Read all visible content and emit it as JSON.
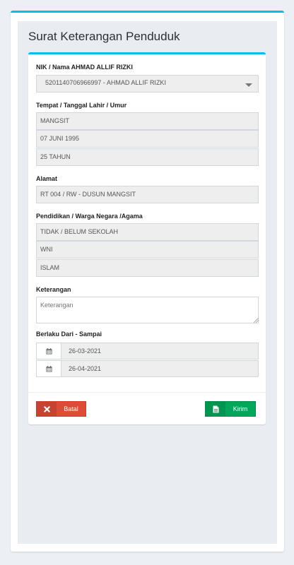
{
  "page": {
    "title": "Surat Keterangan Penduduk"
  },
  "form": {
    "nik": {
      "label": "NIK / Nama AHMAD ALLIF RIZKI",
      "value": "5201140706966997 - AHMAD ALLIF RIZKI"
    },
    "birth": {
      "label": "Tempat / Tanggal Lahir / Umur",
      "place": "MANGSIT",
      "date": "07 JUNI 1995",
      "age": "25 TAHUN"
    },
    "address": {
      "label": "Alamat",
      "value": "RT 004 / RW - DUSUN MANGSIT"
    },
    "education": {
      "label": "Pendidikan / Warga Negara /Agama",
      "education": "TIDAK / BELUM SEKOLAH",
      "citizenship": "WNI",
      "religion": " ISLAM"
    },
    "remarks": {
      "label": "Keterangan",
      "placeholder": "Keterangan"
    },
    "validity": {
      "label": "Berlaku Dari - Sampai",
      "from": "26-03-2021",
      "to": "26-04-2021"
    }
  },
  "buttons": {
    "cancel_label": "Batal",
    "submit_label": "Kirim"
  },
  "colors": {
    "accent": "#00c0ef",
    "danger": "#dd4b39",
    "success": "#00a65a"
  },
  "icons": {
    "date": "calendar-icon",
    "cancel": "times-icon",
    "submit": "file-icon",
    "select": "caret-down-icon"
  }
}
